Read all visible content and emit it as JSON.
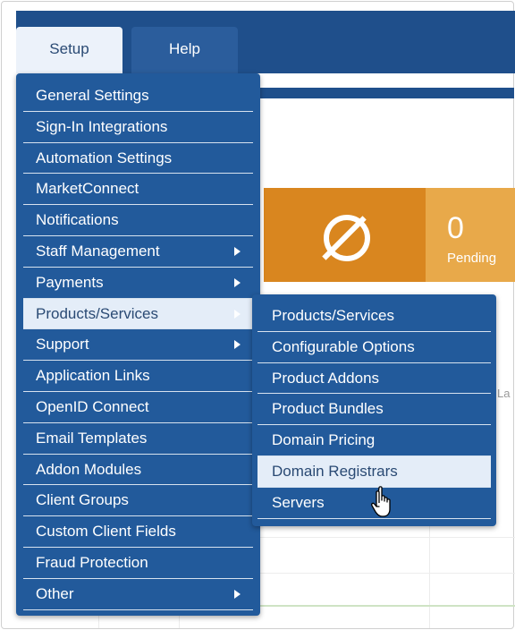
{
  "nav": {
    "tabs": [
      {
        "label": "Setup"
      },
      {
        "label": "Help"
      }
    ]
  },
  "stat_panel": {
    "count": "0",
    "label": "Pending",
    "icon": "ban-icon"
  },
  "truncated_label": "La",
  "setup_menu": {
    "items": [
      {
        "label": "General Settings",
        "has_submenu": false
      },
      {
        "label": "Sign-In Integrations",
        "has_submenu": false
      },
      {
        "label": "Automation Settings",
        "has_submenu": false
      },
      {
        "label": "MarketConnect",
        "has_submenu": false
      },
      {
        "label": "Notifications",
        "has_submenu": false
      },
      {
        "label": "Staff Management",
        "has_submenu": true
      },
      {
        "label": "Payments",
        "has_submenu": true
      },
      {
        "label": "Products/Services",
        "has_submenu": true,
        "active": true
      },
      {
        "label": "Support",
        "has_submenu": true
      },
      {
        "label": "Application Links",
        "has_submenu": false
      },
      {
        "label": "OpenID Connect",
        "has_submenu": false
      },
      {
        "label": "Email Templates",
        "has_submenu": false
      },
      {
        "label": "Addon Modules",
        "has_submenu": false
      },
      {
        "label": "Client Groups",
        "has_submenu": false
      },
      {
        "label": "Custom Client Fields",
        "has_submenu": false
      },
      {
        "label": "Fraud Protection",
        "has_submenu": false
      },
      {
        "label": "Other",
        "has_submenu": true
      }
    ]
  },
  "products_submenu": {
    "items": [
      {
        "label": "Products/Services"
      },
      {
        "label": "Configurable Options"
      },
      {
        "label": "Product Addons"
      },
      {
        "label": "Product Bundles"
      },
      {
        "label": "Domain Pricing"
      },
      {
        "label": "Domain Registrars",
        "hovered": true
      },
      {
        "label": "Servers"
      }
    ]
  },
  "colors": {
    "menu_bg": "#225a9b",
    "nav_bg": "#1f4f8b",
    "item_highlight": "#e4edf8",
    "stat_orange": "#d9861f",
    "stat_light_orange": "#e8a94a"
  }
}
